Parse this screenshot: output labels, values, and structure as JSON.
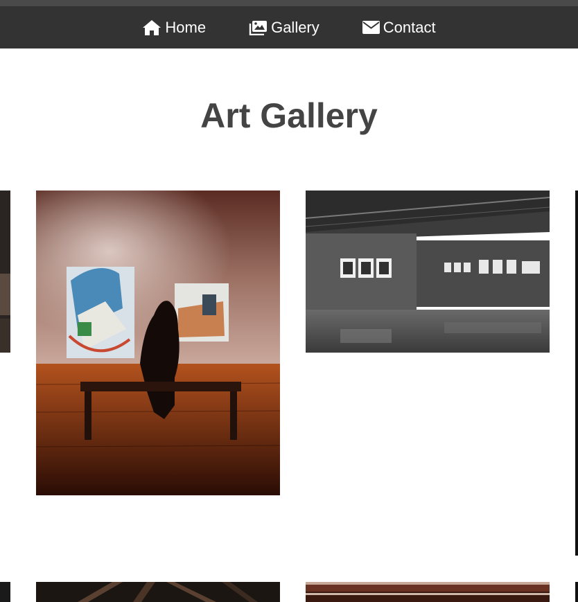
{
  "nav": {
    "items": [
      {
        "label": "Home",
        "icon": "home-icon"
      },
      {
        "label": "Gallery",
        "icon": "images-icon"
      },
      {
        "label": "Contact",
        "icon": "envelope-icon"
      }
    ]
  },
  "page": {
    "title": "Art Gallery"
  },
  "gallery": {
    "images": [
      {
        "subject": "woman seated on bench viewing paintings"
      },
      {
        "subject": "grey gallery room with framed photographs"
      },
      {
        "subject": "dark wooden beams partially visible"
      },
      {
        "subject": "interior with lit cornice partially visible"
      }
    ]
  },
  "colors": {
    "nav_bg": "#333333",
    "title": "#444444",
    "nav_text": "#ffffff"
  }
}
